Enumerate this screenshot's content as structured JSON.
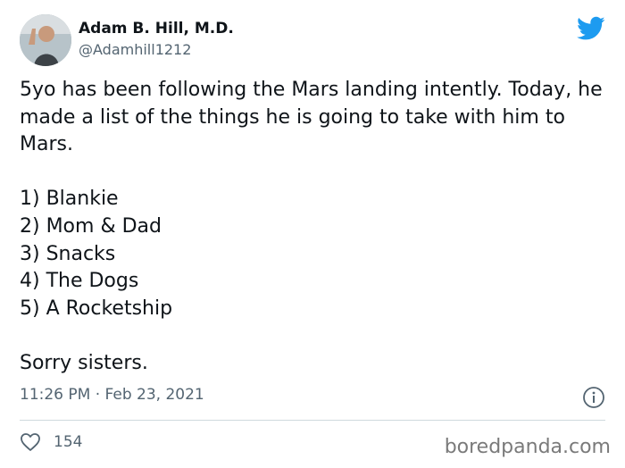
{
  "author": {
    "name": "Adam B. Hill, M.D.",
    "handle": "@Adamhill1212"
  },
  "tweet": {
    "paragraphs": [
      "5yo has been following the Mars landing intently. Today, he made a list of the things he is going to take with him to Mars.",
      "",
      "1) Blankie",
      "2) Mom & Dad",
      "3) Snacks",
      "4) The Dogs",
      "5) A Rocketship",
      "",
      "Sorry sisters."
    ],
    "timestamp": "11:26 PM · Feb 23, 2021",
    "likes": "154"
  },
  "icons": {
    "brand": "twitter-bird-icon",
    "info": "info-icon",
    "like": "heart-icon"
  },
  "colors": {
    "brand": "#1d9bf0",
    "secondary_text": "#536471",
    "divider": "#cfd9de"
  },
  "watermark": "boredpanda.com"
}
